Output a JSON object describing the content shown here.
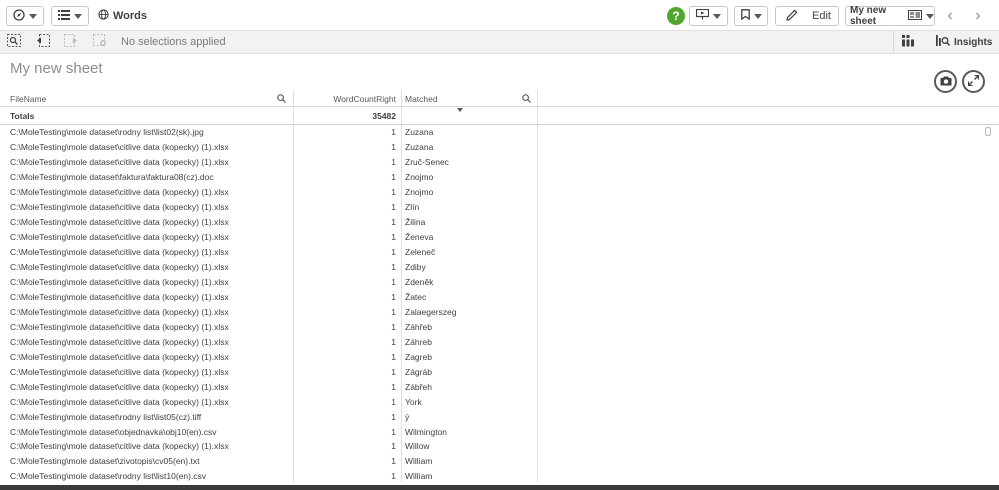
{
  "topbar": {
    "app_title": "Words",
    "help_label": "?",
    "edit_label": "Edit",
    "sheet_selector_label": "My new sheet"
  },
  "selections": {
    "status_text": "No selections applied",
    "insights_label": "Insights"
  },
  "sheet": {
    "title": "My new sheet"
  },
  "table": {
    "headers": {
      "filename": "FileName",
      "wordcount": "WordCountRight",
      "matched": "Matched"
    },
    "totals": {
      "label": "Totals",
      "wordcount": "35482"
    },
    "rows": [
      {
        "file": "C:\\MoleTesting\\mole dataset\\rodny list\\list02(sk).jpg",
        "count": "1",
        "matched": "Zuzana"
      },
      {
        "file": "C:\\MoleTesting\\mole dataset\\citlive data (kopecky) (1).xlsx",
        "count": "1",
        "matched": "Zuzana"
      },
      {
        "file": "C:\\MoleTesting\\mole dataset\\citlive data (kopecky) (1).xlsx",
        "count": "1",
        "matched": "Zruč-Senec"
      },
      {
        "file": "C:\\MoleTesting\\mole dataset\\faktura\\faktura08(cz).doc",
        "count": "1",
        "matched": "Znojmo"
      },
      {
        "file": "C:\\MoleTesting\\mole dataset\\citlive data (kopecky) (1).xlsx",
        "count": "1",
        "matched": "Znojmo"
      },
      {
        "file": "C:\\MoleTesting\\mole dataset\\citlive data (kopecky) (1).xlsx",
        "count": "1",
        "matched": "Zlín"
      },
      {
        "file": "C:\\MoleTesting\\mole dataset\\citlive data (kopecky) (1).xlsx",
        "count": "1",
        "matched": "Žilina"
      },
      {
        "file": "C:\\MoleTesting\\mole dataset\\citlive data (kopecky) (1).xlsx",
        "count": "1",
        "matched": "Ženeva"
      },
      {
        "file": "C:\\MoleTesting\\mole dataset\\citlive data (kopecky) (1).xlsx",
        "count": "1",
        "matched": "Zeleneč"
      },
      {
        "file": "C:\\MoleTesting\\mole dataset\\citlive data (kopecky) (1).xlsx",
        "count": "1",
        "matched": "Zdiby"
      },
      {
        "file": "C:\\MoleTesting\\mole dataset\\citlive data (kopecky) (1).xlsx",
        "count": "1",
        "matched": "Zdeněk"
      },
      {
        "file": "C:\\MoleTesting\\mole dataset\\citlive data (kopecky) (1).xlsx",
        "count": "1",
        "matched": "Žatec"
      },
      {
        "file": "C:\\MoleTesting\\mole dataset\\citlive data (kopecky) (1).xlsx",
        "count": "1",
        "matched": "Zalaegerszeg"
      },
      {
        "file": "C:\\MoleTesting\\mole dataset\\citlive data (kopecky) (1).xlsx",
        "count": "1",
        "matched": "Záhřeb"
      },
      {
        "file": "C:\\MoleTesting\\mole dataset\\citlive data (kopecky) (1).xlsx",
        "count": "1",
        "matched": "Záhreb"
      },
      {
        "file": "C:\\MoleTesting\\mole dataset\\citlive data (kopecky) (1).xlsx",
        "count": "1",
        "matched": "Zagreb"
      },
      {
        "file": "C:\\MoleTesting\\mole dataset\\citlive data (kopecky) (1).xlsx",
        "count": "1",
        "matched": "Zágráb"
      },
      {
        "file": "C:\\MoleTesting\\mole dataset\\citlive data (kopecky) (1).xlsx",
        "count": "1",
        "matched": "Zábřeh"
      },
      {
        "file": "C:\\MoleTesting\\mole dataset\\citlive data (kopecky) (1).xlsx",
        "count": "1",
        "matched": "York"
      },
      {
        "file": "C:\\MoleTesting\\mole dataset\\rodny list\\list05(cz).tiff",
        "count": "1",
        "matched": "ý"
      },
      {
        "file": "C:\\MoleTesting\\mole dataset\\objednavka\\obj10(en).csv",
        "count": "1",
        "matched": "Wilmington"
      },
      {
        "file": "C:\\MoleTesting\\mole dataset\\citlive data (kopecky) (1).xlsx",
        "count": "1",
        "matched": "Willow"
      },
      {
        "file": "C:\\MoleTesting\\mole dataset\\zivotopis\\cv05(en).txt",
        "count": "1",
        "matched": "William"
      },
      {
        "file": "C:\\MoleTesting\\mole dataset\\rodny list\\list10(en).csv",
        "count": "1",
        "matched": "William"
      }
    ]
  },
  "colors": {
    "help_green": "#52a62e",
    "text": "#404040",
    "muted": "#8c8c8c"
  }
}
